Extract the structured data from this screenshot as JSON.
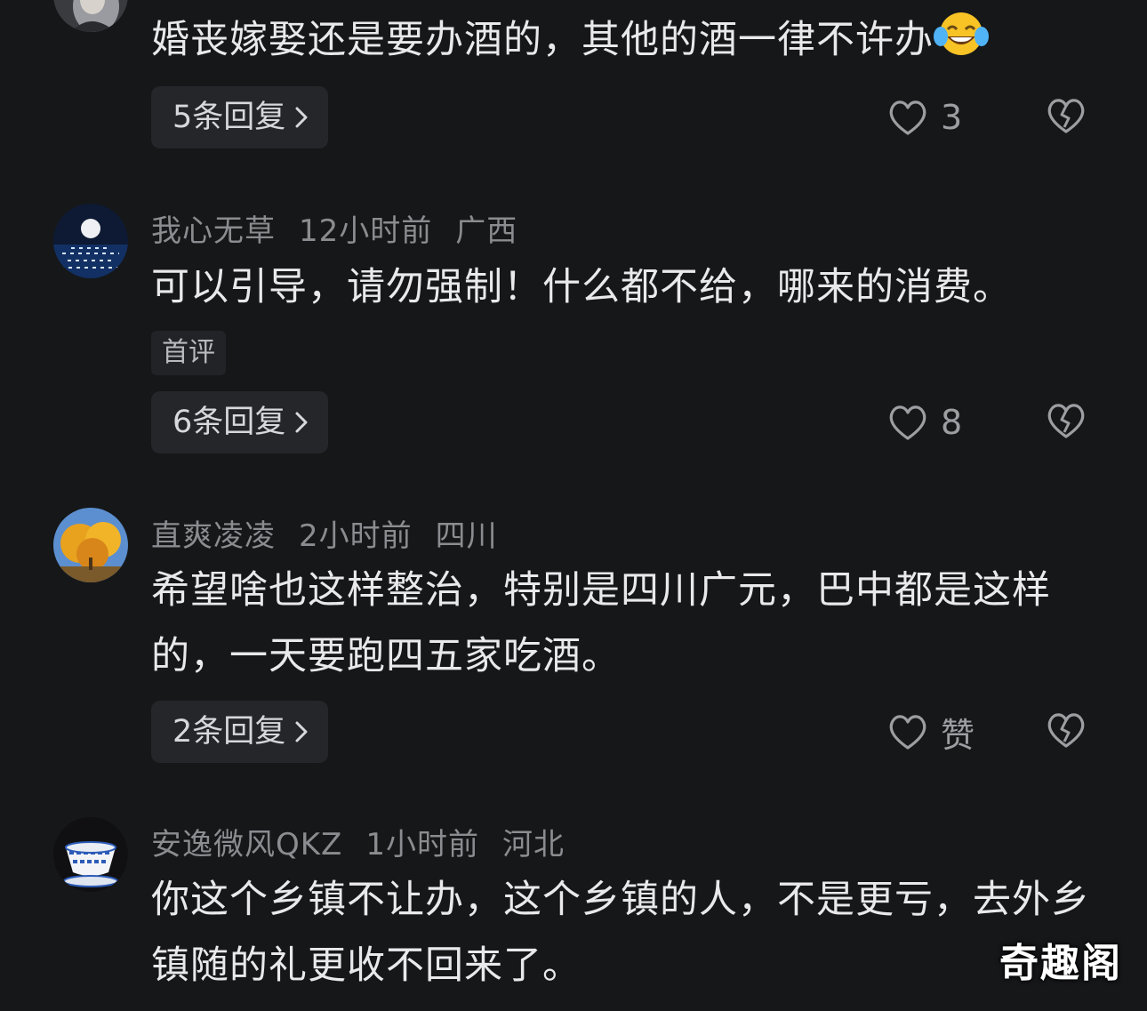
{
  "comments": [
    {
      "text": "婚丧嫁娶还是要办酒的，其他的酒一律不许办",
      "replies": "5条回复",
      "likes": "3"
    },
    {
      "username": "我心无草",
      "time": "12小时前",
      "location": "广西",
      "text": "可以引导，请勿强制！什么都不给，哪来的消费。",
      "tag": "首评",
      "replies": "6条回复",
      "likes": "8"
    },
    {
      "username": "直爽凌凌",
      "time": "2小时前",
      "location": "四川",
      "text": "希望啥也这样整治，特别是四川广元，巴中都是这样的，一天要跑四五家吃酒。",
      "replies": "2条回复",
      "likes": "赞"
    },
    {
      "username": "安逸微风QKZ",
      "time": "1小时前",
      "location": "河北",
      "text": "你这个乡镇不让办，这个乡镇的人，不是更亏，去外乡镇随的礼更收不回来了。"
    }
  ],
  "icons": {
    "like": "heart-outline-icon",
    "dislike": "broken-heart-icon",
    "chevron": "chevron-right-icon",
    "emoji": "tears-of-joy-emoji"
  },
  "watermark": "奇趣阁",
  "colors": {
    "background": "#161719",
    "meta": "#8b8c90",
    "text": "#e9e9ec",
    "button": "#25262a"
  }
}
